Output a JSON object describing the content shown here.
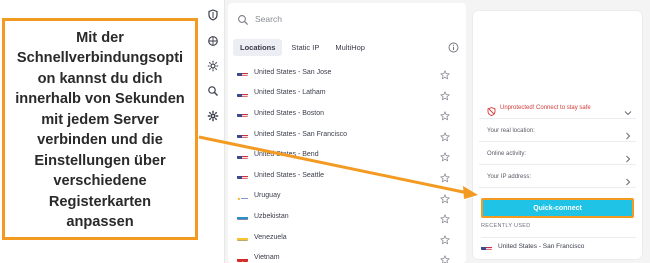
{
  "annotation": {
    "text": "Mit der\nSchnellverbindungsopti\non kannst du dich\ninnerhalb von Sekunden\nmit jedem Server\nverbinden und die\nEinstellungen über\nverschiedene\nRegisterkarten\nanpassen",
    "border_color": "#f39a22"
  },
  "sidebar": {
    "icons": [
      "shield-icon",
      "globe-icon",
      "settings-gear-icon",
      "search-ip-icon",
      "settings-cog-icon"
    ]
  },
  "search": {
    "placeholder": "Search",
    "value": ""
  },
  "tabs": [
    {
      "label": "Locations",
      "active": true
    },
    {
      "label": "Static IP",
      "active": false
    },
    {
      "label": "MultiHop",
      "active": false
    }
  ],
  "locations": [
    {
      "flag": "us",
      "label": "United States - San Jose"
    },
    {
      "flag": "us",
      "label": "United States - Latham"
    },
    {
      "flag": "us",
      "label": "United States - Boston"
    },
    {
      "flag": "us",
      "label": "United States - San Francisco"
    },
    {
      "flag": "us",
      "label": "United States - Bend"
    },
    {
      "flag": "us",
      "label": "United States - Seattle"
    },
    {
      "flag": "uy",
      "label": "Uruguay"
    },
    {
      "flag": "uz",
      "label": "Uzbekistan"
    },
    {
      "flag": "ve",
      "label": "Venezuela"
    },
    {
      "flag": "vn",
      "label": "Vietnam"
    }
  ],
  "status": {
    "warning": "Unprotected! Connect to stay safe",
    "real_location_label": "Your real location:",
    "online_activity_label": "Online activity:",
    "ip_address_label": "Your IP address:"
  },
  "quick_connect": {
    "label": "Quick-connect"
  },
  "recently_used": {
    "heading": "RECENTLY USED",
    "items": [
      {
        "flag": "us",
        "label": "United States - San Francisco"
      }
    ]
  },
  "colors": {
    "accent": "#1ec3e6",
    "highlight": "#f39a22",
    "warning": "#d33a3a"
  }
}
